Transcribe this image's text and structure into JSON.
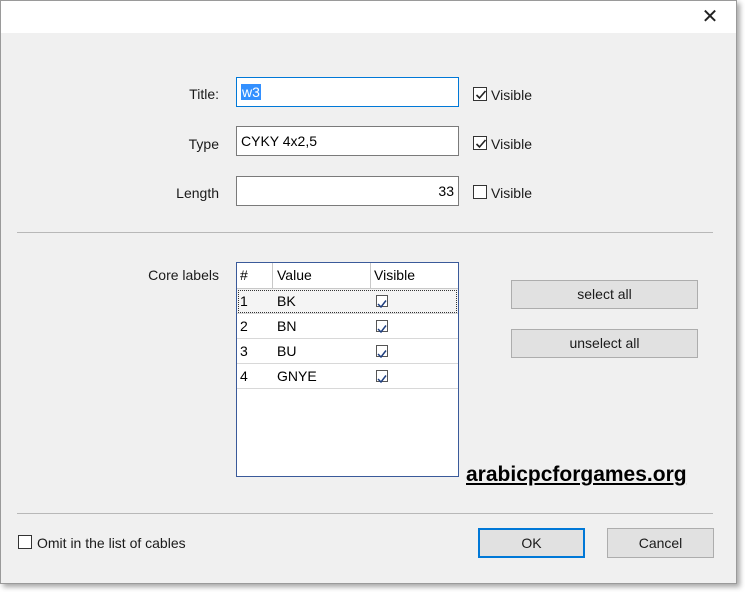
{
  "window": {
    "close_glyph": "✕"
  },
  "fields": {
    "title": {
      "label": "Title:",
      "value": "w3",
      "visible_label": "Visible",
      "visible_checked": true
    },
    "type": {
      "label": "Type",
      "value": "CYKY 4x2,5",
      "visible_label": "Visible",
      "visible_checked": true
    },
    "length": {
      "label": "Length",
      "value": "33",
      "visible_label": "Visible",
      "visible_checked": false
    }
  },
  "core_labels": {
    "label": "Core labels",
    "columns": [
      "#",
      "Value",
      "Visible"
    ],
    "rows": [
      {
        "num": "1",
        "value": "BK",
        "visible": true
      },
      {
        "num": "2",
        "value": "BN",
        "visible": true
      },
      {
        "num": "3",
        "value": "BU",
        "visible": true
      },
      {
        "num": "4",
        "value": "GNYE",
        "visible": true
      }
    ]
  },
  "buttons": {
    "select_all": "select all",
    "unselect_all": "unselect all",
    "ok": "OK",
    "cancel": "Cancel"
  },
  "omit": {
    "label": "Omit in the list of cables",
    "checked": false
  },
  "watermark": "arabicpcforgames.org"
}
